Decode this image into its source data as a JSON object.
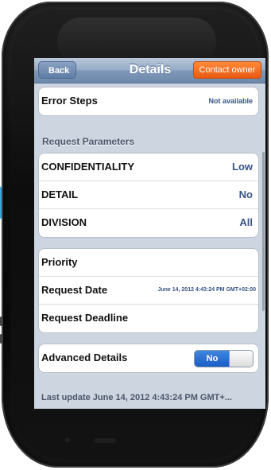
{
  "navbar": {
    "back_label": "Back",
    "title": "Details",
    "contact_label": "Contact owner"
  },
  "error_steps": {
    "label": "Error Steps",
    "value": "Not available"
  },
  "request_parameters": {
    "header": "Request Parameters",
    "rows": [
      {
        "label": "CONFIDENTIALITY",
        "value": "Low"
      },
      {
        "label": "DETAIL",
        "value": "No"
      },
      {
        "label": "DIVISION",
        "value": "All"
      }
    ]
  },
  "request_info": {
    "rows": [
      {
        "label": "Priority",
        "value": ""
      },
      {
        "label": "Request Date",
        "value": "June 14, 2012 4:43:24 PM GMT+02:00"
      },
      {
        "label": "Request Deadline",
        "value": ""
      }
    ]
  },
  "advanced": {
    "label": "Advanced Details",
    "toggle_value": "No"
  },
  "footer": {
    "last_update": "Last update June 14, 2012 4:43:24 PM GMT+..."
  },
  "colors": {
    "accent_blue": "#3aa8e6",
    "nav_bar": "#8aa2c2",
    "contact_orange": "#f26a1b",
    "value_text": "#385487",
    "toggle_blue": "#2a6fd6"
  }
}
